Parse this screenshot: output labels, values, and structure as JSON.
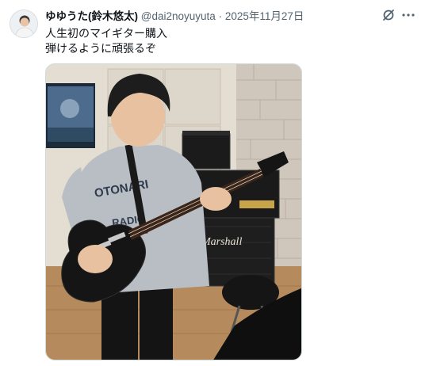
{
  "tweet": {
    "display_name": "ゆゆうた(鈴木悠太)",
    "handle": "@dai2noyuyuta",
    "separator": "·",
    "date": "2025年11月27日",
    "text_line1": "人生初のマイギター購入",
    "text_line2": "弾けるように頑張るぞ"
  },
  "photo": {
    "amp_brand": "Marshall",
    "shirt_print": [
      "OTONARI",
      "RADIO"
    ]
  },
  "icons": [
    "avatar",
    "grok-icon",
    "more-icon"
  ],
  "colors": {
    "secondary_text": "#536471",
    "primary_text": "#0f1419",
    "border": "#cfd9de"
  }
}
